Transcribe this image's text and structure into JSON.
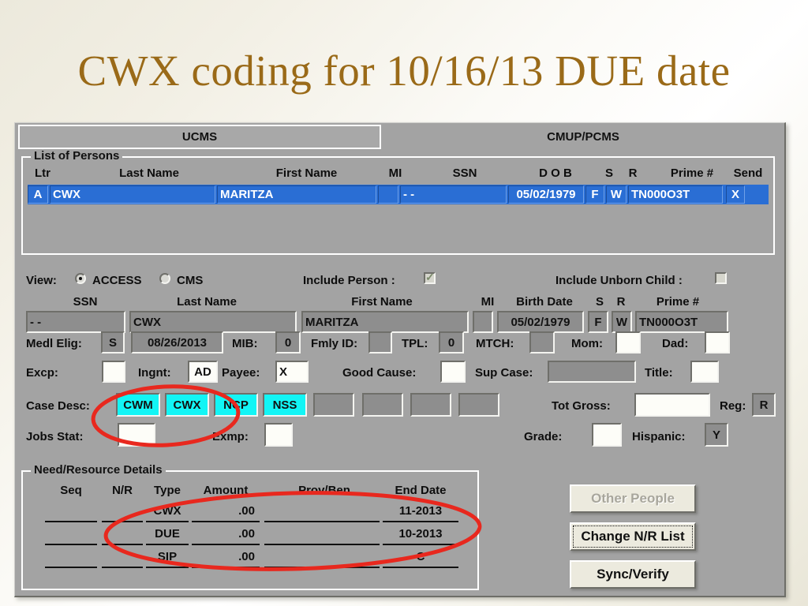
{
  "slide": {
    "title": "CWX coding for 10/16/13 DUE date",
    "title_color": "#9a6a18"
  },
  "tabs": [
    {
      "label": "UCMS",
      "active": true
    },
    {
      "label": "CMUP/PCMS",
      "active": false
    }
  ],
  "persons_group": {
    "legend": "List of Persons",
    "columns": [
      "Ltr",
      "Last Name",
      "First Name",
      "MI",
      "SSN",
      "D O B",
      "S",
      "R",
      "Prime #",
      "Send"
    ],
    "row": {
      "ltr": "A",
      "last_name": "CWX",
      "first_name": "MARITZA",
      "mi": "",
      "ssn": "- -",
      "dob": "05/02/1979",
      "sex": "F",
      "race": "W",
      "prime": "TN000O3T",
      "send": "X"
    },
    "selection_color": "#2a6ed4"
  },
  "view_row": {
    "view_label": "View:",
    "access_label": "ACCESS",
    "cms_label": "CMS",
    "selected": "ACCESS",
    "include_person_label": "Include Person :",
    "include_person_checked": true,
    "include_unborn_label": "Include Unborn Child :",
    "include_unborn_checked": false
  },
  "detail_headers": [
    "SSN",
    "Last Name",
    "First Name",
    "MI",
    "Birth Date",
    "S",
    "R",
    "Prime #"
  ],
  "detail_row": {
    "ssn": "- -",
    "last_name": "CWX",
    "first_name": "MARITZA",
    "mi": "",
    "birth_date": "05/02/1979",
    "sex": "F",
    "race": "W",
    "prime": "TN000O3T"
  },
  "medl_row": {
    "medl_elig_label": "Medl Elig:",
    "medl_elig_value": "S",
    "medl_elig_date": "08/26/2013",
    "mib_label": "MIB:",
    "mib_value": "0",
    "fmly_id_label": "Fmly ID:",
    "fmly_id_value": "",
    "tpl_label": "TPL:",
    "tpl_value": "0",
    "mtch_label": "MTCH:",
    "mtch_value": "",
    "mom_label": "Mom:",
    "mom_value": "",
    "dad_label": "Dad:",
    "dad_value": ""
  },
  "excp_row": {
    "excp_label": "Excp:",
    "excp_value": "",
    "ingnt_label": "Ingnt:",
    "ingnt_value": "AD",
    "payee_label": "Payee:",
    "payee_value": "X",
    "good_cause_label": "Good Cause:",
    "good_cause_value": "",
    "sup_case_label": "Sup Case:",
    "sup_case_value": "",
    "title_label": "Title:",
    "title_value": ""
  },
  "case_desc_row": {
    "label": "Case Desc:",
    "codes": [
      "CWM",
      "CWX",
      "NCP",
      "NSS"
    ],
    "highlight_color": "#12f5f5",
    "empty_slots": 4,
    "tot_gross_label": "Tot Gross:",
    "tot_gross_value": "",
    "reg_label": "Reg:",
    "reg_value": "R"
  },
  "jobs_row": {
    "jobs_stat_label": "Jobs Stat:",
    "jobs_stat_value": "",
    "exmp_label": "Exmp:",
    "exmp_value": "",
    "grade_label": "Grade:",
    "grade_value": "",
    "hispanic_label": "Hispanic:",
    "hispanic_value": "Y"
  },
  "need_resource": {
    "legend": "Need/Resource Details",
    "columns": [
      "Seq",
      "N/R",
      "Type",
      "Amount",
      "Prov/Ben",
      "End Date"
    ],
    "rows": [
      {
        "seq": "",
        "nr": "",
        "type": "CWX",
        "amount": ".00",
        "prov_ben": "",
        "end_date": "11-2013"
      },
      {
        "seq": "",
        "nr": "",
        "type": "DUE",
        "amount": ".00",
        "prov_ben": "",
        "end_date": "10-2013"
      },
      {
        "seq": "",
        "nr": "",
        "type": "SIP",
        "amount": ".00",
        "prov_ben": "",
        "end_date": "C"
      }
    ]
  },
  "buttons": {
    "other_people": "Other People",
    "change_nr_list": "Change N/R List",
    "sync_verify": "Sync/Verify"
  },
  "annotations": {
    "color": "#e8281e",
    "items": [
      "case-desc-codes-ellipse",
      "need-resource-ellipse"
    ]
  }
}
